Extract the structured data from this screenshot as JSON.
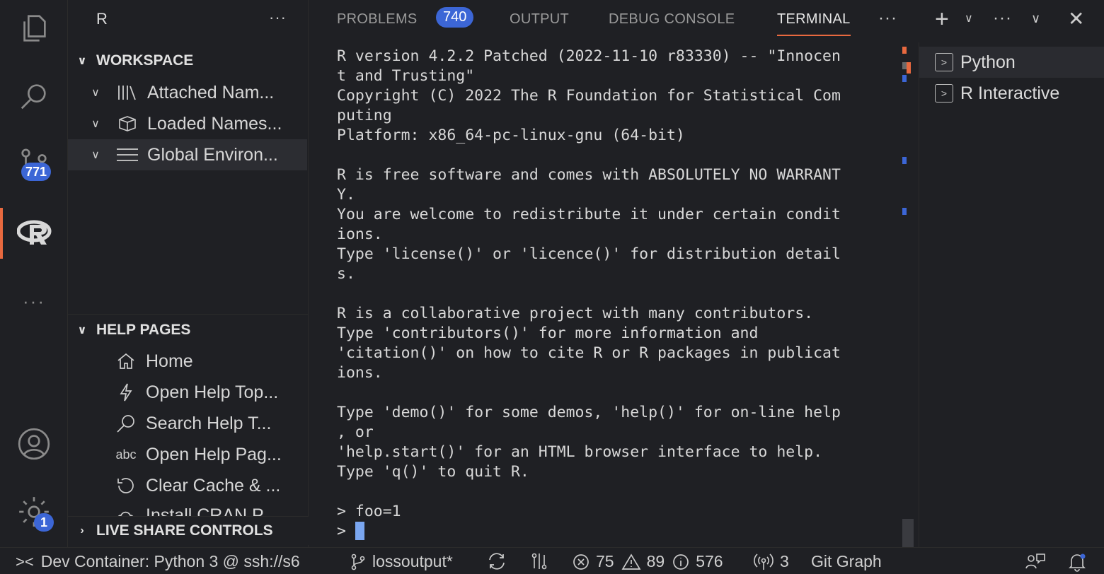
{
  "sidebar": {
    "title": "R",
    "more": "···",
    "workspace": {
      "header": "WORKSPACE",
      "items": [
        {
          "label": "Attached Nam...",
          "icon": "library-icon"
        },
        {
          "label": "Loaded Names...",
          "icon": "package-icon"
        },
        {
          "label": "Global Environ...",
          "icon": "list-icon"
        }
      ]
    },
    "help": {
      "header": "HELP PAGES",
      "items": [
        {
          "label": "Home",
          "icon": "home-icon"
        },
        {
          "label": "Open Help Top...",
          "icon": "lightning-icon"
        },
        {
          "label": "Search Help T...",
          "icon": "search-icon"
        },
        {
          "label": "Open Help Pag...",
          "icon": "abc-icon"
        },
        {
          "label": "Clear Cache & ...",
          "icon": "refresh-icon"
        },
        {
          "label": "Install CRAN P...",
          "icon": "cloud-icon"
        }
      ]
    },
    "live_share": {
      "header": "LIVE SHARE CONTROLS"
    }
  },
  "activity": {
    "scm_badge": "771",
    "settings_badge": "1"
  },
  "panel": {
    "tabs": [
      {
        "label": "PROBLEMS",
        "badge": "740"
      },
      {
        "label": "OUTPUT"
      },
      {
        "label": "DEBUG CONSOLE"
      },
      {
        "label": "TERMINAL",
        "active": true
      }
    ],
    "terminal_lines": [
      "R version 4.2.2 Patched (2022-11-10 r83330) -- \"Innocen",
      "t and Trusting\"",
      "Copyright (C) 2022 The R Foundation for Statistical Com",
      "puting",
      "Platform: x86_64-pc-linux-gnu (64-bit)",
      "",
      "R is free software and comes with ABSOLUTELY NO WARRANT",
      "Y.",
      "You are welcome to redistribute it under certain condit",
      "ions.",
      "Type 'license()' or 'licence()' for distribution detail",
      "s.",
      "",
      "R is a collaborative project with many contributors.",
      "Type 'contributors()' for more information and",
      "'citation()' on how to cite R or R packages in publicat",
      "ions.",
      "",
      "Type 'demo()' for some demos, 'help()' for on-line help",
      ", or",
      "'help.start()' for an HTML browser interface to help.",
      "Type 'q()' to quit R.",
      "",
      "> foo=1"
    ],
    "prompt": "> ",
    "terminals": [
      {
        "label": "Python"
      },
      {
        "label": "R Interactive"
      }
    ]
  },
  "status": {
    "remote": "Dev Container: Python 3 @ ssh://s6",
    "branch": "lossoutput*",
    "errors": "75",
    "warnings": "89",
    "infos": "576",
    "ports": "3",
    "git_graph": "Git Graph"
  },
  "colors": {
    "accent": "#e8693f",
    "badge": "#3c66d6",
    "background": "#1f2024"
  }
}
